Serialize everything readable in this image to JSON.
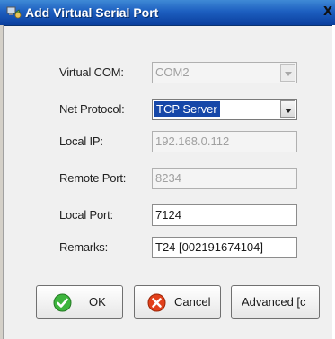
{
  "window": {
    "title": "Add Virtual Serial Port",
    "close_label": "X"
  },
  "form": {
    "virtual_com": {
      "label": "Virtual COM:",
      "value": "COM2",
      "enabled": false
    },
    "net_protocol": {
      "label": "Net Protocol:",
      "value": "TCP Server",
      "enabled": true
    },
    "local_ip": {
      "label": "Local IP:",
      "value": "192.168.0.112",
      "enabled": false
    },
    "remote_port": {
      "label": "Remote Port:",
      "value": "8234",
      "enabled": false
    },
    "local_port": {
      "label": "Local Port:",
      "value": "7124",
      "enabled": true
    },
    "remarks": {
      "label": "Remarks:",
      "value": "T24 [002191674104]",
      "enabled": true
    }
  },
  "buttons": {
    "ok": {
      "label": "OK",
      "icon": "check-icon",
      "icon_color": "#3db53d"
    },
    "cancel": {
      "label": "Cancel",
      "icon": "cancel-icon",
      "icon_color": "#e2401b"
    },
    "advanced": {
      "label": "Advanced [c"
    }
  },
  "colors": {
    "titlebar": "#1d5fc0",
    "selection": "#1647a8",
    "dialog_bg": "#f0f0f0"
  }
}
